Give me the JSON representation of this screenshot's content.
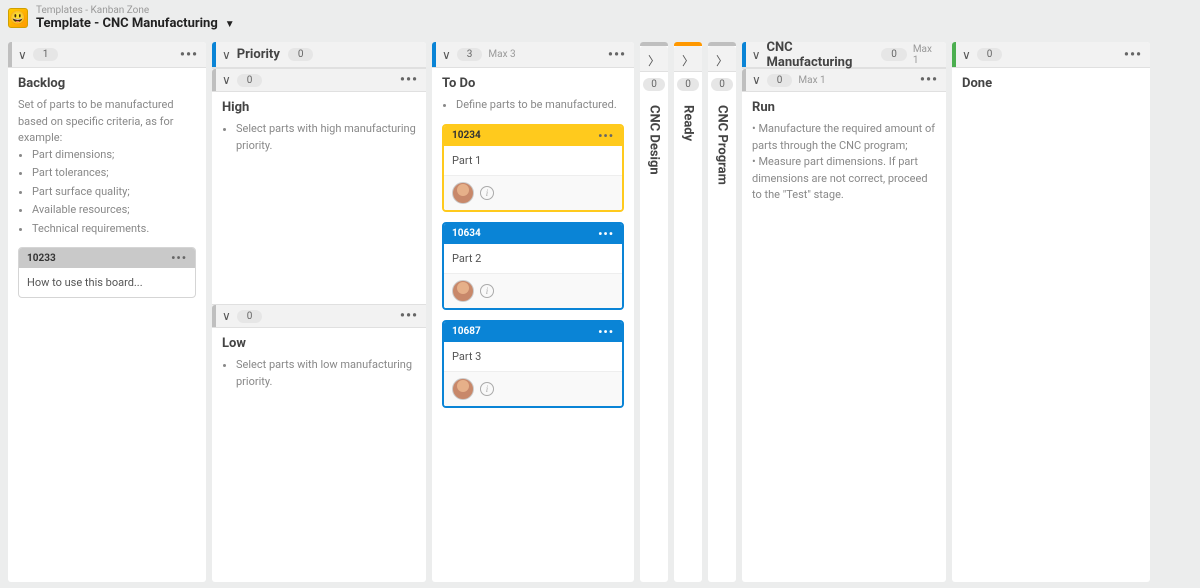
{
  "breadcrumb": "Templates - Kanban Zone",
  "board_title": "Template - CNC Manufacturing",
  "logo_emoji": "😃",
  "columns": {
    "backlog": {
      "count": "1",
      "title": "Backlog",
      "description": "Set of parts to be manufactured based on specific criteria, as for example:",
      "bullets": [
        "Part dimensions;",
        "Part tolerances;",
        "Part surface quality;",
        "Available resources;",
        "Technical requirements."
      ],
      "card": {
        "id": "10233",
        "title": "How to use this board..."
      }
    },
    "priority": {
      "title": "Priority",
      "count": "0",
      "high": {
        "count": "0",
        "title": "High",
        "desc": "Select parts with high manufacturing priority."
      },
      "low": {
        "count": "0",
        "title": "Low",
        "desc": "Select parts with low manufacturing priority."
      }
    },
    "todo": {
      "count": "3",
      "max": "Max 3",
      "title": "To Do",
      "desc": "Define parts to be manufactured.",
      "cards": [
        {
          "id": "10234",
          "title": "Part 1",
          "color": "yellow"
        },
        {
          "id": "10634",
          "title": "Part 2",
          "color": "blue"
        },
        {
          "id": "10687",
          "title": "Part 3",
          "color": "blue"
        }
      ]
    },
    "cnc_design": {
      "count": "0",
      "title": "CNC Design"
    },
    "ready": {
      "count": "0",
      "title": "Ready"
    },
    "cnc_program": {
      "count": "0",
      "title": "CNC Program"
    },
    "cnc_manufacturing": {
      "title": "CNC Manufacturing",
      "count": "0",
      "max": "Max 1",
      "run": {
        "count": "0",
        "max": "Max 1",
        "title": "Run",
        "desc": "• Manufacture the required amount of parts through the CNC program;\n• Measure part dimensions. If part dimensions are not correct, proceed to the \"Test\" stage."
      }
    },
    "done": {
      "count": "0",
      "title": "Done"
    }
  }
}
